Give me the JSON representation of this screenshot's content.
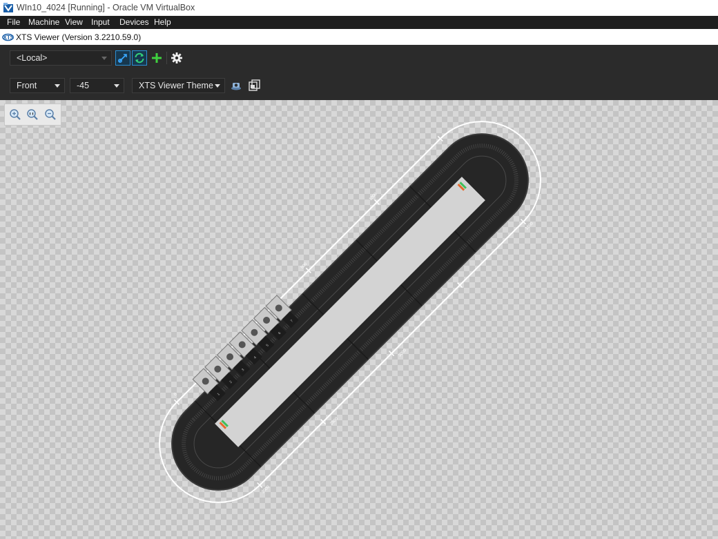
{
  "window": {
    "title": "WIn10_4024 [Running] - Oracle VM VirtualBox",
    "icon": "virtualbox-icon"
  },
  "menu": [
    "File",
    "Machine",
    "View",
    "Input",
    "Devices",
    "Help"
  ],
  "app": {
    "title": "XTS Viewer (Version 3.2210.59.0)",
    "icon": "xts-viewer-icon"
  },
  "toolbar": {
    "target": "<Local>",
    "view": "Front",
    "angle": "-45",
    "theme": "XTS Viewer Theme",
    "icons": [
      "connect-icon",
      "refresh-icon",
      "add-icon",
      "gear-icon",
      "camera-icon",
      "layout-icon"
    ],
    "accent_color": "#2a8fd6",
    "add_color": "#3fd13f"
  },
  "zoom": {
    "icons": [
      "zoom-in-icon",
      "zoom-fit-icon",
      "zoom-out-icon"
    ]
  },
  "track": {
    "dimension_labels": [
      "0",
      "500",
      "1000",
      "1500",
      "2000",
      "2500",
      "3000"
    ],
    "mover_count": 7,
    "mover_labels": [
      "1",
      "2",
      "3",
      "4",
      "5",
      "6",
      "7"
    ],
    "background_color": "#262626",
    "mover_color": "#c9c9c9"
  }
}
